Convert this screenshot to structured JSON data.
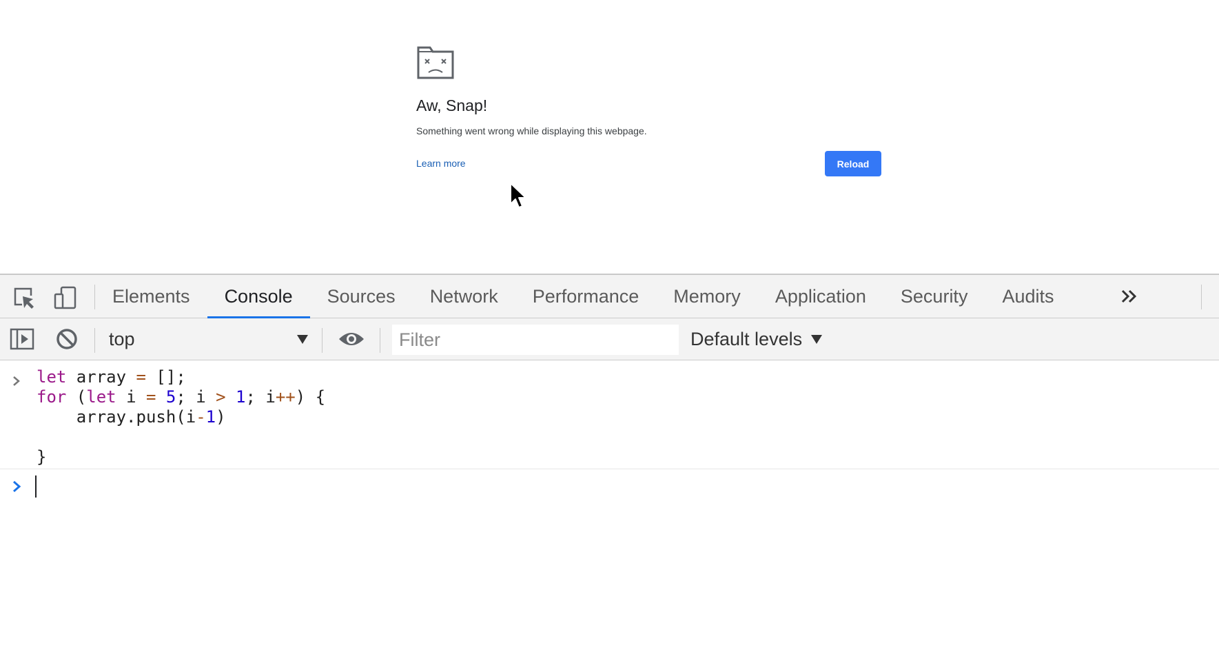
{
  "error_page": {
    "title": "Aw, Snap!",
    "message": "Something went wrong while displaying this webpage.",
    "learn_more_label": "Learn more",
    "reload_label": "Reload",
    "reload_color": "#3478f6"
  },
  "devtools": {
    "tabs": [
      {
        "label": "Elements"
      },
      {
        "label": "Console",
        "active": true
      },
      {
        "label": "Sources"
      },
      {
        "label": "Network"
      },
      {
        "label": "Performance"
      },
      {
        "label": "Memory"
      },
      {
        "label": "Application"
      },
      {
        "label": "Security"
      },
      {
        "label": "Audits"
      }
    ],
    "active_tab_color": "#1a73e8",
    "icons": [
      "inspect-icon",
      "device-toggle-icon",
      "more-tabs-icon",
      "sidebar-toggle-icon",
      "clear-console-icon",
      "eye-icon"
    ],
    "console_toolbar": {
      "context": "top",
      "filter_placeholder": "Filter",
      "levels_label": "Default levels"
    },
    "console": {
      "entry_code": [
        "let array = [];",
        "for (let i = 5; i > 1; i++) {",
        "    array.push(i-1)",
        "",
        "}"
      ],
      "prompt_value": ""
    }
  }
}
